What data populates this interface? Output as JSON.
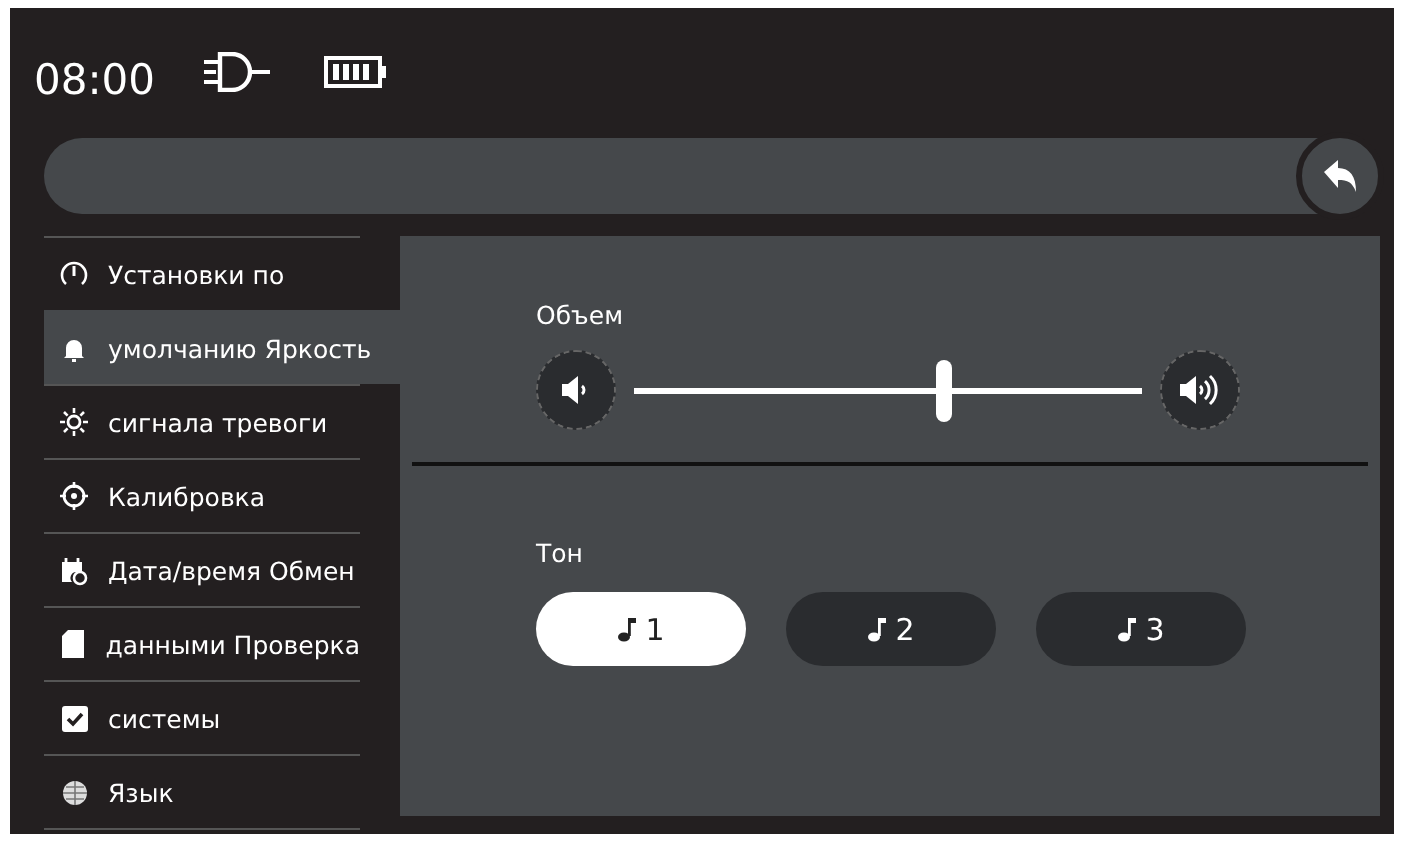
{
  "status": {
    "time": "08:00"
  },
  "menu": [
    {
      "label": "Установки по",
      "selected": false
    },
    {
      "label": "умолчанию Яркость",
      "selected": true
    },
    {
      "label": "сигнала тревоги",
      "selected": false
    },
    {
      "label": "Калибровка",
      "selected": false
    },
    {
      "label": "Дата/время Обмен",
      "selected": false
    },
    {
      "label": "данными Проверка",
      "selected": false
    },
    {
      "label": "системы",
      "selected": false
    },
    {
      "label": "Язык",
      "selected": false
    }
  ],
  "volume": {
    "label": "Объем",
    "level": 0.61
  },
  "tone": {
    "label": "Тон",
    "options": [
      {
        "label": "1",
        "selected": true
      },
      {
        "label": "2",
        "selected": false
      },
      {
        "label": "3",
        "selected": false
      }
    ]
  }
}
